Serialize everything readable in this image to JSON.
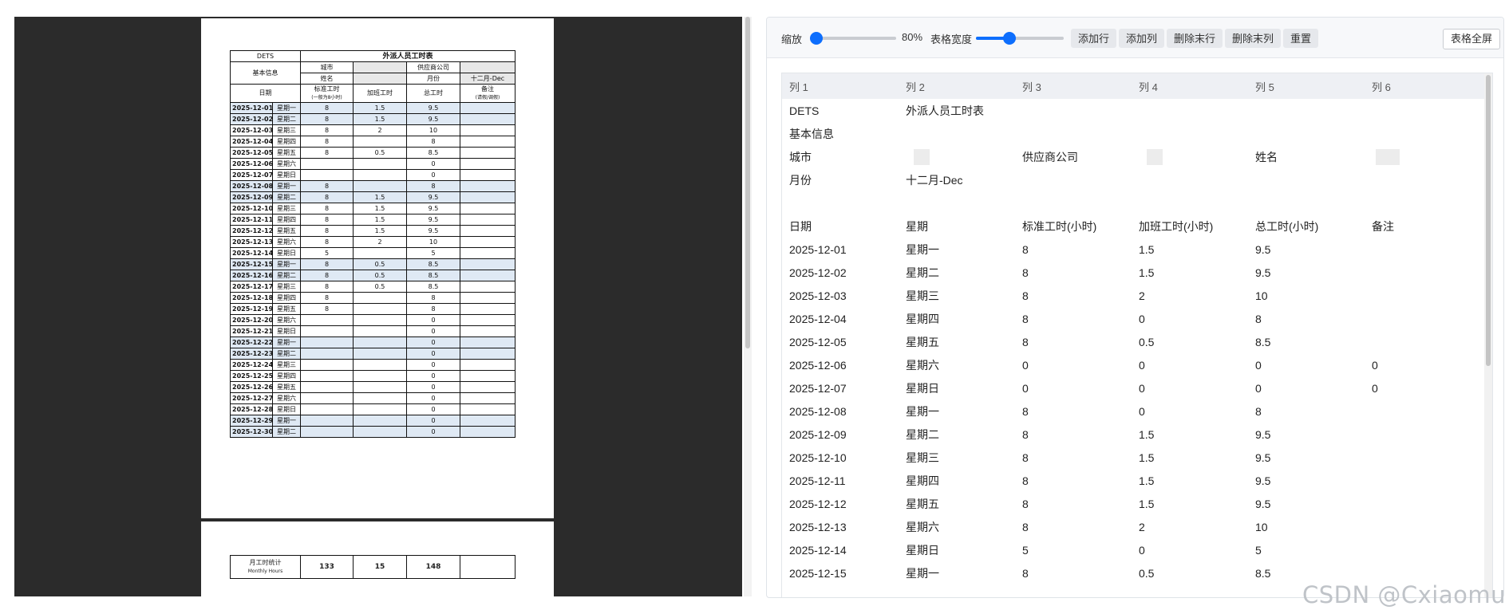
{
  "preview": {
    "sheet_code": "DETS",
    "sheet_title": "外派人员工时表",
    "basic_info_label": "基本信息",
    "city_label": "城市",
    "supplier_label": "供应商公司",
    "name_label": "姓名",
    "month_label": "月份",
    "month_value": "十二月-Dec",
    "col_date": "日期",
    "col_std": "标准工时",
    "col_std_note": "(一般为8小时)",
    "col_ot": "加班工时",
    "col_total": "总工时",
    "col_remark": "备注",
    "col_remark_note": "(请假/调假)",
    "rows": [
      {
        "date": "2025-12-01",
        "weekday": "星期一",
        "std": "8",
        "ot": "1.5",
        "total": "9.5",
        "hl": true
      },
      {
        "date": "2025-12-02",
        "weekday": "星期二",
        "std": "8",
        "ot": "1.5",
        "total": "9.5",
        "hl": true
      },
      {
        "date": "2025-12-03",
        "weekday": "星期三",
        "std": "8",
        "ot": "2",
        "total": "10",
        "hl": false
      },
      {
        "date": "2025-12-04",
        "weekday": "星期四",
        "std": "8",
        "ot": "",
        "total": "8",
        "hl": false
      },
      {
        "date": "2025-12-05",
        "weekday": "星期五",
        "std": "8",
        "ot": "0.5",
        "total": "8.5",
        "hl": false
      },
      {
        "date": "2025-12-06",
        "weekday": "星期六",
        "std": "",
        "ot": "",
        "total": "0",
        "hl": false
      },
      {
        "date": "2025-12-07",
        "weekday": "星期日",
        "std": "",
        "ot": "",
        "total": "0",
        "hl": false
      },
      {
        "date": "2025-12-08",
        "weekday": "星期一",
        "std": "8",
        "ot": "",
        "total": "8",
        "hl": true
      },
      {
        "date": "2025-12-09",
        "weekday": "星期二",
        "std": "8",
        "ot": "1.5",
        "total": "9.5",
        "hl": true
      },
      {
        "date": "2025-12-10",
        "weekday": "星期三",
        "std": "8",
        "ot": "1.5",
        "total": "9.5",
        "hl": false
      },
      {
        "date": "2025-12-11",
        "weekday": "星期四",
        "std": "8",
        "ot": "1.5",
        "total": "9.5",
        "hl": false
      },
      {
        "date": "2025-12-12",
        "weekday": "星期五",
        "std": "8",
        "ot": "1.5",
        "total": "9.5",
        "hl": false
      },
      {
        "date": "2025-12-13",
        "weekday": "星期六",
        "std": "8",
        "ot": "2",
        "total": "10",
        "hl": false
      },
      {
        "date": "2025-12-14",
        "weekday": "星期日",
        "std": "5",
        "ot": "",
        "total": "5",
        "hl": false
      },
      {
        "date": "2025-12-15",
        "weekday": "星期一",
        "std": "8",
        "ot": "0.5",
        "total": "8.5",
        "hl": true
      },
      {
        "date": "2025-12-16",
        "weekday": "星期二",
        "std": "8",
        "ot": "0.5",
        "total": "8.5",
        "hl": true
      },
      {
        "date": "2025-12-17",
        "weekday": "星期三",
        "std": "8",
        "ot": "0.5",
        "total": "8.5",
        "hl": false
      },
      {
        "date": "2025-12-18",
        "weekday": "星期四",
        "std": "8",
        "ot": "",
        "total": "8",
        "hl": false
      },
      {
        "date": "2025-12-19",
        "weekday": "星期五",
        "std": "8",
        "ot": "",
        "total": "8",
        "hl": false
      },
      {
        "date": "2025-12-20",
        "weekday": "星期六",
        "std": "",
        "ot": "",
        "total": "0",
        "hl": false
      },
      {
        "date": "2025-12-21",
        "weekday": "星期日",
        "std": "",
        "ot": "",
        "total": "0",
        "hl": false
      },
      {
        "date": "2025-12-22",
        "weekday": "星期一",
        "std": "",
        "ot": "",
        "total": "0",
        "hl": true
      },
      {
        "date": "2025-12-23",
        "weekday": "星期二",
        "std": "",
        "ot": "",
        "total": "0",
        "hl": true
      },
      {
        "date": "2025-12-24",
        "weekday": "星期三",
        "std": "",
        "ot": "",
        "total": "0",
        "hl": false
      },
      {
        "date": "2025-12-25",
        "weekday": "星期四",
        "std": "",
        "ot": "",
        "total": "0",
        "hl": false
      },
      {
        "date": "2025-12-26",
        "weekday": "星期五",
        "std": "",
        "ot": "",
        "total": "0",
        "hl": false
      },
      {
        "date": "2025-12-27",
        "weekday": "星期六",
        "std": "",
        "ot": "",
        "total": "0",
        "hl": false
      },
      {
        "date": "2025-12-28",
        "weekday": "星期日",
        "std": "",
        "ot": "",
        "total": "0",
        "hl": false
      },
      {
        "date": "2025-12-29",
        "weekday": "星期一",
        "std": "",
        "ot": "",
        "total": "0",
        "hl": true
      },
      {
        "date": "2025-12-30",
        "weekday": "星期二",
        "std": "",
        "ot": "",
        "total": "0",
        "hl": true
      }
    ],
    "monthly_label": "月工时统计",
    "monthly_label_en": "Monthly Hours",
    "monthly_std": "133",
    "monthly_ot": "15",
    "monthly_total": "148"
  },
  "toolbar": {
    "zoom_label": "缩放",
    "zoom_value": "80%",
    "zoom_fraction": 0.0,
    "width_label": "表格宽度",
    "width_fraction": 0.38,
    "add_row": "添加行",
    "add_col": "添加列",
    "del_last_row": "删除末行",
    "del_last_col": "删除末列",
    "reset": "重置",
    "fullscreen": "表格全屏"
  },
  "grid": {
    "headers": [
      "列 1",
      "列 2",
      "列 3",
      "列 4",
      "列 5",
      "列 6"
    ],
    "rows": [
      [
        "DETS",
        "外派人员工时表",
        "",
        "",
        "",
        ""
      ],
      [
        "基本信息",
        "",
        "",
        "",
        "",
        ""
      ],
      [
        "城市",
        "[blur]",
        "供应商公司",
        "[blur]",
        "姓名",
        "[blurwide]"
      ],
      [
        "月份",
        "十二月-Dec",
        "",
        "",
        "",
        ""
      ],
      [
        "",
        "",
        "",
        "",
        "",
        ""
      ],
      [
        "日期",
        "星期",
        "标准工时(小时)",
        "加班工时(小时)",
        "总工时(小时)",
        "备注"
      ],
      [
        "2025-12-01",
        "星期一",
        "8",
        "1.5",
        "9.5",
        ""
      ],
      [
        "2025-12-02",
        "星期二",
        "8",
        "1.5",
        "9.5",
        ""
      ],
      [
        "2025-12-03",
        "星期三",
        "8",
        "2",
        "10",
        ""
      ],
      [
        "2025-12-04",
        "星期四",
        "8",
        "0",
        "8",
        ""
      ],
      [
        "2025-12-05",
        "星期五",
        "8",
        "0.5",
        "8.5",
        ""
      ],
      [
        "2025-12-06",
        "星期六",
        "0",
        "0",
        "0",
        "0"
      ],
      [
        "2025-12-07",
        "星期日",
        "0",
        "0",
        "0",
        "0"
      ],
      [
        "2025-12-08",
        "星期一",
        "8",
        "0",
        "8",
        ""
      ],
      [
        "2025-12-09",
        "星期二",
        "8",
        "1.5",
        "9.5",
        ""
      ],
      [
        "2025-12-10",
        "星期三",
        "8",
        "1.5",
        "9.5",
        ""
      ],
      [
        "2025-12-11",
        "星期四",
        "8",
        "1.5",
        "9.5",
        ""
      ],
      [
        "2025-12-12",
        "星期五",
        "8",
        "1.5",
        "9.5",
        ""
      ],
      [
        "2025-12-13",
        "星期六",
        "8",
        "2",
        "10",
        ""
      ],
      [
        "2025-12-14",
        "星期日",
        "5",
        "0",
        "5",
        ""
      ],
      [
        "2025-12-15",
        "星期一",
        "8",
        "0.5",
        "8.5",
        ""
      ]
    ]
  },
  "watermark": "CSDN @Cxiaomu"
}
